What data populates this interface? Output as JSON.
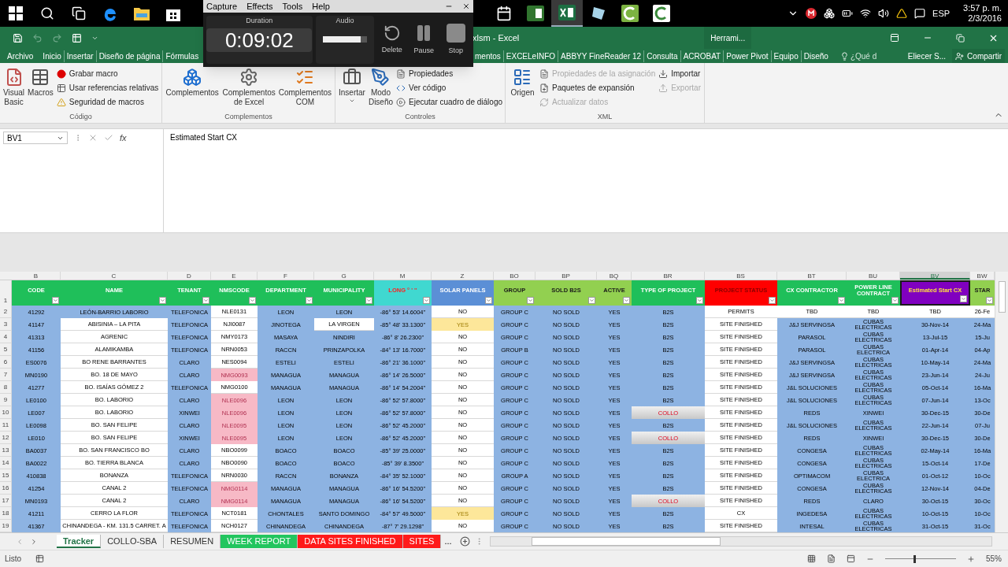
{
  "taskbar": {
    "buttons": [
      {
        "kind": "start",
        "selected": false
      },
      {
        "kind": "search",
        "selected": false
      },
      {
        "kind": "taskview",
        "selected": false
      },
      {
        "kind": "browser",
        "selected": false
      },
      {
        "kind": "folder",
        "selected": false
      },
      {
        "kind": "store",
        "selected": false
      },
      {
        "kind": "calendar",
        "selected": false
      },
      {
        "kind": "project",
        "selected": false
      },
      {
        "kind": "excel",
        "selected": true
      },
      {
        "kind": "notes",
        "selected": false
      },
      {
        "kind": "recorder",
        "selected": false
      },
      {
        "kind": "recorder_alt",
        "selected": false
      }
    ],
    "tray": {
      "language": "ESP",
      "time": "3:57 p. m.",
      "date": "2/3/2016"
    }
  },
  "recorder": {
    "menu": [
      "Capture",
      "Effects",
      "Tools",
      "Help"
    ],
    "duration_label": "Duration",
    "duration": "0:09:02",
    "audio_label": "Audio",
    "audio": {
      "level": 0.85
    },
    "buttons": [
      {
        "kind": "delete",
        "label": "Delete"
      },
      {
        "kind": "pause",
        "label": "Pause"
      },
      {
        "kind": "stop",
        "label": "Stop"
      }
    ]
  },
  "window": {
    "title": "xlsm - Excel",
    "context_group": "Herrami..."
  },
  "ribbon_tabs": {
    "left": [
      "Archivo",
      "Inicio",
      "Insertar",
      "Diseño de página",
      "Fórmulas"
    ],
    "right": [
      "mentos",
      "EXCELeINFO",
      "ABBYY FineReader 12",
      "Consulta",
      "ACROBAT",
      "Power Pivot",
      "Equipo",
      "Diseño"
    ],
    "tell_me": "¿Qué d",
    "user": "Eliecer S...",
    "share": "Compartir"
  },
  "ribbon": {
    "groups": [
      {
        "label": "Código",
        "large": [
          {
            "kind": "vba",
            "label": "Visual Basic"
          },
          {
            "kind": "macros",
            "label": "Macros"
          }
        ],
        "small": [
          [
            {
              "kind": "record",
              "label": "Grabar macro",
              "disabled": false
            },
            {
              "kind": "relative",
              "label": "Usar referencias relativas",
              "disabled": false
            },
            {
              "kind": "warning",
              "label": "Seguridad de macros",
              "disabled": false
            }
          ]
        ]
      },
      {
        "label": "Complementos",
        "large": [
          {
            "kind": "addins",
            "label": "Complementos"
          },
          {
            "kind": "gears",
            "label": "Complementos de Excel"
          },
          {
            "kind": "com",
            "label": "Complementos COM"
          }
        ]
      },
      {
        "label": "Controles",
        "large": [
          {
            "kind": "insert",
            "label": "Insertar"
          },
          {
            "kind": "design",
            "label": "Modo Diseño"
          }
        ],
        "small": [
          [
            {
              "kind": "properties",
              "label": "Propiedades",
              "disabled": false
            },
            {
              "kind": "code",
              "label": "Ver código",
              "disabled": false
            },
            {
              "kind": "dialog",
              "label": "Ejecutar cuadro de diálogo",
              "disabled": false
            }
          ]
        ]
      },
      {
        "label": "XML",
        "large": [
          {
            "kind": "source",
            "label": "Origen"
          }
        ],
        "small": [
          [
            {
              "kind": "properties",
              "label": "Propiedades de la asignación",
              "disabled": true
            },
            {
              "kind": "packs",
              "label": "Paquetes de expansión",
              "disabled": false
            },
            {
              "kind": "refresh",
              "label": "Actualizar datos",
              "disabled": true
            }
          ],
          [
            {
              "kind": "import",
              "label": "Importar",
              "disabled": false
            },
            {
              "kind": "export",
              "label": "Exportar",
              "disabled": true
            }
          ]
        ]
      }
    ]
  },
  "formula_bar": {
    "name_box": "BV1",
    "function_label": "fx",
    "formula": "Estimated Start CX"
  },
  "sheet": {
    "header_row": "1",
    "columns": [
      {
        "letter": "B",
        "label": "CODE",
        "color": "#1fbf5a",
        "kind": "blue",
        "selected": false
      },
      {
        "letter": "C",
        "label": "NAME",
        "color": "#1fbf5a",
        "kind": "white",
        "selected": false
      },
      {
        "letter": "D",
        "label": "TENANT",
        "color": "#1fbf5a",
        "kind": "blue",
        "selected": false
      },
      {
        "letter": "E",
        "label": "NMSCODE",
        "color": "#1fbf5a",
        "kind": "white",
        "selected": false
      },
      {
        "letter": "F",
        "label": "DEPARTMENT",
        "color": "#1fbf5a",
        "kind": "blue",
        "selected": false
      },
      {
        "letter": "G",
        "label": "MUNICIPALITY",
        "color": "#1fbf5a",
        "kind": "blue",
        "selected": false
      },
      {
        "letter": "M",
        "label": "LONG ° ' ''",
        "color": "#40d8d0",
        "kind": "blue",
        "selected": false
      },
      {
        "letter": "Z",
        "label": "SOLAR PANELS",
        "color": "#5b8fd6",
        "kind": "white",
        "selected": false
      },
      {
        "letter": "BO",
        "label": "GROUP",
        "color": "#92d050",
        "kind": "blue",
        "selected": false
      },
      {
        "letter": "BP",
        "label": "SOLD B2S",
        "color": "#92d050",
        "kind": "blue",
        "selected": false
      },
      {
        "letter": "BQ",
        "label": "ACTIVE",
        "color": "#92d050",
        "kind": "blue",
        "selected": false
      },
      {
        "letter": "BR",
        "label": "TYPE OF PROJECT",
        "color": "#1fbf5a",
        "kind": "blue",
        "selected": false
      },
      {
        "letter": "BS",
        "label": "PROJECT STATUS",
        "color": "#ff0000",
        "kind": "white",
        "selected": false
      },
      {
        "letter": "BT",
        "label": "CX CONTRACTOR",
        "color": "#1fbf5a",
        "kind": "blue",
        "selected": false
      },
      {
        "letter": "BU",
        "label": "POWER LINE CONTRACT",
        "color": "#1fbf5a",
        "kind": "blue",
        "selected": false
      },
      {
        "letter": "BV",
        "label": "Estimated Start CX",
        "color": "#8000c0",
        "kind": "blue",
        "selected": true
      },
      {
        "letter": "BW",
        "label": "STAR",
        "color": "#92d050",
        "kind": "blue",
        "selected": false
      }
    ],
    "rows": [
      {
        "number": "2",
        "pending": true,
        "nms_flag": false,
        "solar_flag": false,
        "collo": false,
        "municipality_flag": false,
        "cells": [
          "41292",
          "LEÓN-BARRIO LABORIO",
          "TELEFONICA",
          "NLE0131",
          "LEON",
          "LEON",
          "-86° 53' 14.6004''",
          "NO",
          "GROUP C",
          "NO SOLD",
          "YES",
          "B2S",
          "PERMITS",
          "TBD",
          "TBD",
          "TBD",
          "26-Fe"
        ]
      },
      {
        "number": "3",
        "pending": false,
        "nms_flag": false,
        "solar_flag": true,
        "collo": false,
        "municipality_flag": true,
        "cells": [
          "41147",
          "ABISINIA – LA PITA",
          "TELEFONICA",
          "NJI0087",
          "JINOTEGA",
          "LA VIRGEN",
          "-85° 48' 33.1300''",
          "YES",
          "GROUP C",
          "NO SOLD",
          "YES",
          "B2S",
          "SITE FINISHED",
          "J&J SERVINGSA",
          "CUBAS ELECTRICAS",
          "30-Nov-14",
          "24-Ma"
        ]
      },
      {
        "number": "4",
        "pending": false,
        "nms_flag": false,
        "solar_flag": false,
        "collo": false,
        "municipality_flag": false,
        "cells": [
          "41313",
          "AGRENIC",
          "TELEFONICA",
          "NMY0173",
          "MASAYA",
          "NINDIRI",
          "-86° 8' 26.2300''",
          "NO",
          "GROUP C",
          "NO SOLD",
          "YES",
          "B2S",
          "SITE FINISHED",
          "PARASOL",
          "CUBAS ELECTRICAS",
          "13-Jul-15",
          "15-Ju"
        ]
      },
      {
        "number": "5",
        "pending": false,
        "nms_flag": false,
        "solar_flag": false,
        "collo": false,
        "municipality_flag": false,
        "cells": [
          "41156",
          "ALAMIKAMBA",
          "TELEFONICA",
          "NRN0053",
          "RACCN",
          "PRINZAPOLKA",
          "-84° 13' 16.7000''",
          "NO",
          "GROUP B",
          "NO SOLD",
          "YES",
          "B2S",
          "SITE FINISHED",
          "PARASOL",
          "CUBAS ELECTRICA",
          "01-Apr-14",
          "04-Ap"
        ]
      },
      {
        "number": "6",
        "pending": false,
        "nms_flag": false,
        "solar_flag": false,
        "collo": false,
        "municipality_flag": false,
        "cells": [
          "ES0076",
          "BO RENE BARRANTES",
          "CLARO",
          "NES0094",
          "ESTELI",
          "ESTELI",
          "-86° 21' 36.1000''",
          "NO",
          "GROUP C",
          "NO SOLD",
          "YES",
          "B2S",
          "SITE FINISHED",
          "J&J SERVINGSA",
          "CUBAS ELECTRICAS",
          "10-May-14",
          "24-Ma"
        ]
      },
      {
        "number": "7",
        "pending": false,
        "nms_flag": true,
        "solar_flag": false,
        "collo": false,
        "municipality_flag": false,
        "cells": [
          "MN0190",
          "BO. 18 DE MAYO",
          "CLARO",
          "NMG0093",
          "MANAGUA",
          "MANAGUA",
          "-86° 14' 26.5000''",
          "NO",
          "GROUP C",
          "NO SOLD",
          "YES",
          "B2S",
          "SITE FINISHED",
          "J&J SERVINGSA",
          "CUBAS ELECTRICAS",
          "23-Jun-14",
          "24-Ju"
        ]
      },
      {
        "number": "8",
        "pending": false,
        "nms_flag": false,
        "solar_flag": false,
        "collo": false,
        "municipality_flag": false,
        "cells": [
          "41277",
          "BO. ISAÍAS GÓMEZ 2",
          "TELEFONICA",
          "NMG0100",
          "MANAGUA",
          "MANAGUA",
          "-86° 14' 54.2004''",
          "NO",
          "GROUP C",
          "NO SOLD",
          "YES",
          "B2S",
          "SITE FINISHED",
          "J&L SOLUCIONES",
          "CUBAS ELECTRICAS",
          "05-Oct-14",
          "16-Ma"
        ]
      },
      {
        "number": "9",
        "pending": false,
        "nms_flag": true,
        "solar_flag": false,
        "collo": false,
        "municipality_flag": false,
        "cells": [
          "LE0100",
          "BO. LABORIO",
          "CLARO",
          "NLE0096",
          "LEON",
          "LEON",
          "-86° 52' 57.8000''",
          "NO",
          "GROUP C",
          "NO SOLD",
          "YES",
          "B2S",
          "SITE FINISHED",
          "J&L SOLUCIONES",
          "CUBAS ELECTRICAS",
          "07-Jun-14",
          "13-Oc"
        ]
      },
      {
        "number": "10",
        "pending": false,
        "nms_flag": true,
        "solar_flag": false,
        "collo": true,
        "municipality_flag": false,
        "cells": [
          "LE007",
          "BO. LABORIO",
          "XINWEI",
          "NLE0096",
          "LEON",
          "LEON",
          "-86° 52' 57.8000''",
          "NO",
          "GROUP C",
          "NO SOLD",
          "YES",
          "COLLO",
          "SITE FINISHED",
          "REDS",
          "XINWEI",
          "30-Dec-15",
          "30-De"
        ]
      },
      {
        "number": "11",
        "pending": false,
        "nms_flag": true,
        "solar_flag": false,
        "collo": false,
        "municipality_flag": false,
        "cells": [
          "LE0098",
          "BO. SAN FELIPE",
          "CLARO",
          "NLE0095",
          "LEON",
          "LEON",
          "-86° 52' 45.2000''",
          "NO",
          "GROUP C",
          "NO SOLD",
          "YES",
          "B2S",
          "SITE FINISHED",
          "J&L SOLUCIONES",
          "CUBAS ELECTRICAS",
          "22-Jun-14",
          "07-Ju"
        ]
      },
      {
        "number": "12",
        "pending": false,
        "nms_flag": true,
        "solar_flag": false,
        "collo": true,
        "municipality_flag": false,
        "cells": [
          "LE010",
          "BO. SAN FELIPE",
          "XINWEI",
          "NLE0095",
          "LEON",
          "LEON",
          "-86° 52' 45.2000''",
          "NO",
          "GROUP C",
          "NO SOLD",
          "YES",
          "COLLO",
          "SITE FINISHED",
          "REDS",
          "XINWEI",
          "30-Dec-15",
          "30-De"
        ]
      },
      {
        "number": "13",
        "pending": false,
        "nms_flag": false,
        "solar_flag": false,
        "collo": false,
        "municipality_flag": false,
        "cells": [
          "BA0037",
          "BO. SAN FRANCISCO BO",
          "CLARO",
          "NBO0099",
          "BOACO",
          "BOACO",
          "-85° 39' 25.0000''",
          "NO",
          "GROUP C",
          "NO SOLD",
          "YES",
          "B2S",
          "SITE FINISHED",
          "CONGESA",
          "CUBAS ELECTRICAS",
          "02-May-14",
          "16-Ma"
        ]
      },
      {
        "number": "14",
        "pending": false,
        "nms_flag": false,
        "solar_flag": false,
        "collo": false,
        "municipality_flag": false,
        "cells": [
          "BA0022",
          "BO. TIERRA BLANCA",
          "CLARO",
          "NBO0090",
          "BOACO",
          "BOACO",
          "-85° 39' 8.3500''",
          "NO",
          "GROUP C",
          "NO SOLD",
          "YES",
          "B2S",
          "SITE FINISHED",
          "CONGESA",
          "CUBAS ELECTRICAS",
          "15-Oct-14",
          "17-De"
        ]
      },
      {
        "number": "15",
        "pending": false,
        "nms_flag": false,
        "solar_flag": false,
        "collo": false,
        "municipality_flag": false,
        "cells": [
          "410838",
          "BONANZA",
          "TELEFONICA",
          "NRN0030",
          "RACCN",
          "BONANZA",
          "-84° 35' 52.1000''",
          "NO",
          "GROUP A",
          "NO SOLD",
          "YES",
          "B2S",
          "SITE FINISHED",
          "OPTIMACOM",
          "CUBAS ELECTRICA",
          "01-Oct-12",
          "10-Oc"
        ]
      },
      {
        "number": "16",
        "pending": false,
        "nms_flag": true,
        "solar_flag": false,
        "collo": false,
        "municipality_flag": false,
        "cells": [
          "41254",
          "CANAL 2",
          "TELEFONICA",
          "NMG0114",
          "MANAGUA",
          "MANAGUA",
          "-86° 16' 54.5200''",
          "NO",
          "GROUP C",
          "NO SOLD",
          "YES",
          "B2S",
          "SITE FINISHED",
          "CONGESA",
          "CUBAS ELECTRICAS",
          "12-Nov-14",
          "04-De"
        ]
      },
      {
        "number": "17",
        "pending": false,
        "nms_flag": true,
        "solar_flag": false,
        "collo": true,
        "municipality_flag": false,
        "cells": [
          "MN0193",
          "CANAL 2",
          "CLARO",
          "NMG0114",
          "MANAGUA",
          "MANAGUA",
          "-86° 16' 54.5200''",
          "NO",
          "GROUP C",
          "NO SOLD",
          "YES",
          "COLLO",
          "SITE FINISHED",
          "REDS",
          "CLARO",
          "30-Oct-15",
          "30-Oc"
        ]
      },
      {
        "number": "18",
        "pending": false,
        "nms_flag": false,
        "solar_flag": true,
        "collo": false,
        "municipality_flag": false,
        "cells": [
          "41211",
          "CERRO LA FLOR",
          "TELEFONICA",
          "NCT0181",
          "CHONTALES",
          "SANTO DOMINGO",
          "-84° 57' 49.5000''",
          "YES",
          "GROUP C",
          "NO SOLD",
          "YES",
          "B2S",
          "CX",
          "INGEDESA",
          "CUBAS ELECTRICAS",
          "10-Oct-15",
          "10-Oc"
        ]
      },
      {
        "number": "19",
        "pending": false,
        "nms_flag": false,
        "solar_flag": false,
        "collo": false,
        "municipality_flag": false,
        "cells": [
          "41367",
          "CHINANDEGA - KM. 131.5 CARRET. A",
          "TELEFONICA",
          "NCH0127",
          "CHINANDEGA",
          "CHINANDEGA",
          "-87° 7' 29.1298''",
          "NO",
          "GROUP C",
          "NO SOLD",
          "YES",
          "B2S",
          "SITE FINISHED",
          "INTESAL",
          "CUBAS ELECTRICAS",
          "31-Oct-15",
          "31-Oc"
        ]
      }
    ]
  },
  "sheet_tabs": {
    "tabs": [
      {
        "label": "Tracker",
        "selected": true
      },
      {
        "label": "COLLO-SBA",
        "selected": false
      },
      {
        "label": "RESUMEN",
        "selected": false
      },
      {
        "label": "WEEK REPORT",
        "selected": false,
        "color": "#22c55e"
      },
      {
        "label": "DATA SITES FINISHED",
        "selected": false,
        "color": "#ff1a1a"
      },
      {
        "label": "SITES",
        "selected": false,
        "color": "#ff1a1a"
      }
    ],
    "more": "..."
  },
  "status_bar": {
    "status": "Listo",
    "zoom": {
      "level": 0.4
    },
    "zoom_label": "55%"
  }
}
